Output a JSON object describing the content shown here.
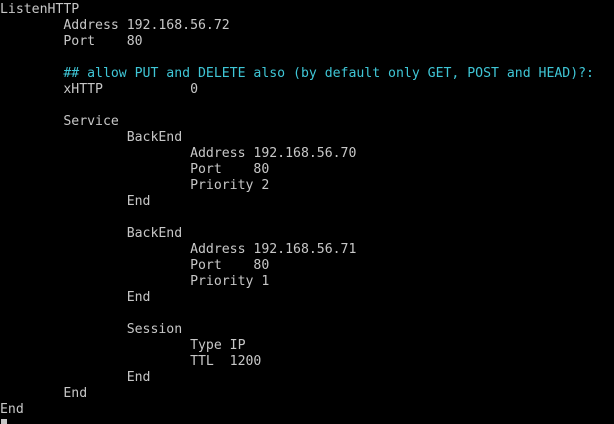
{
  "terminal": {
    "lines": [
      "ListenHTTP",
      "\tAddress 192.168.56.72",
      "\tPort    80",
      "",
      "\t## allow PUT and DELETE also (by default only GET, POST and HEAD)?:",
      "\txHTTP           0",
      "",
      "\tService",
      "\t\tBackEnd",
      "\t\t\tAddress 192.168.56.70",
      "\t\t\tPort    80",
      "\t\t\tPriority 2",
      "\t\tEnd",
      "",
      "\t\tBackEnd",
      "\t\t\tAddress 192.168.56.71",
      "\t\t\tPort    80",
      "\t\t\tPriority 1",
      "\t\tEnd",
      "",
      "\t\tSession",
      "\t\t\tType IP",
      "\t\t\tTTL  1200",
      "\t\tEnd",
      "\tEnd",
      "End"
    ],
    "comment_line_index": 4,
    "colors": {
      "background": "#000000",
      "text": "#c7c7c7",
      "comment": "#3fc6d6"
    }
  }
}
